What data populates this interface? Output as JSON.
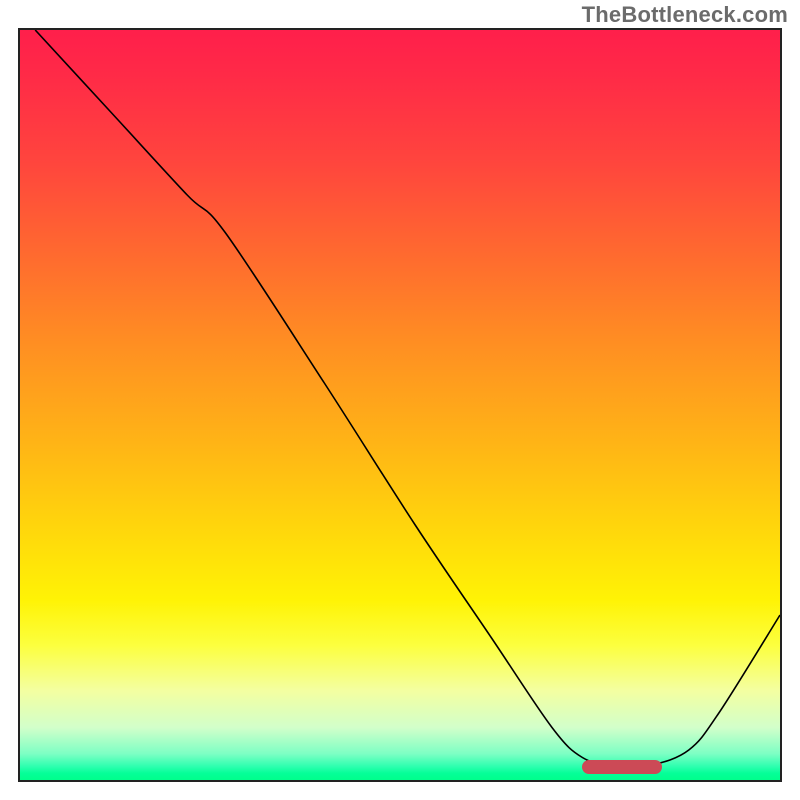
{
  "watermark": "TheBottleneck.com",
  "chart_data": {
    "type": "line",
    "title": "",
    "xlabel": "",
    "ylabel": "",
    "xlim": [
      0,
      100
    ],
    "ylim": [
      0,
      100
    ],
    "grid": false,
    "series": [
      {
        "name": "curve",
        "x": [
          2,
          12,
          22,
          27,
          40,
          52,
          62,
          70,
          74,
          78,
          83,
          88,
          92,
          100
        ],
        "y": [
          100,
          89,
          78,
          73,
          53,
          34,
          19,
          7,
          3,
          2,
          2,
          4,
          9,
          22
        ]
      }
    ],
    "markers": [
      {
        "name": "red-bar",
        "x_start": 74,
        "x_end": 84.5,
        "y": 1.8
      }
    ],
    "gradient_stops": [
      {
        "pct": 0,
        "color": "#ff1f4b"
      },
      {
        "pct": 30,
        "color": "#ff6a2f"
      },
      {
        "pct": 66,
        "color": "#ffd50c"
      },
      {
        "pct": 88,
        "color": "#f4ffa0"
      },
      {
        "pct": 99,
        "color": "#05ff98"
      },
      {
        "pct": 100,
        "color": "#00ff8c"
      }
    ]
  }
}
